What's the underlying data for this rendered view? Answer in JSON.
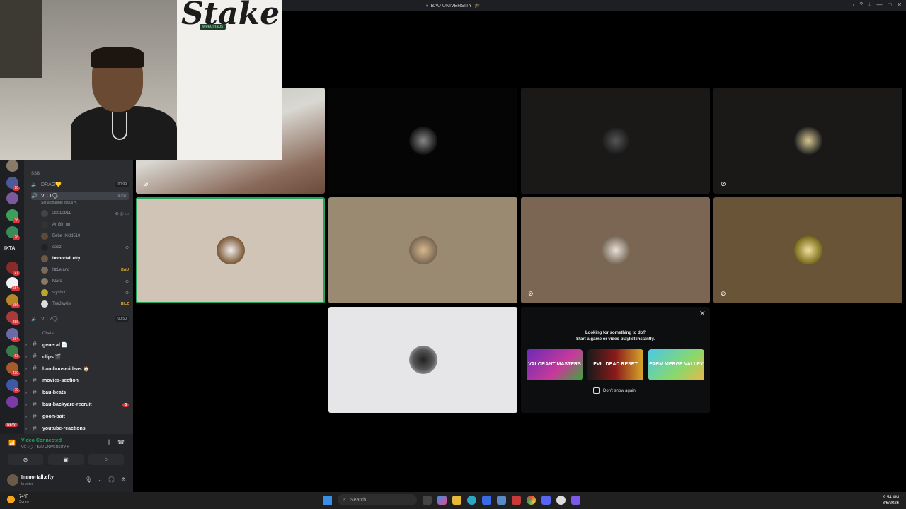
{
  "window": {
    "title": "BAU UNIVERSITY",
    "title_emoji": "🎓"
  },
  "webcam": {
    "logo_text": "Stake",
    "sponsor_text": "weedmaps"
  },
  "servers": {
    "badges": [
      "90",
      "36",
      "26",
      "27",
      "584",
      "156",
      "286",
      "164",
      "63",
      "430",
      "79"
    ],
    "text_server": "IXTA",
    "new_label": "NEW"
  },
  "channels": {
    "category_voice": "SSB",
    "voice_channels": [
      {
        "name": "DRAG💛",
        "limit": "00 99"
      },
      {
        "name": "VC 1🗣",
        "limit": "9 / 57"
      },
      {
        "name": "VC 2🗣",
        "limit": "00 50"
      }
    ],
    "status_hint": "Set a channel status ✎",
    "members": [
      {
        "name": "20010911",
        "tag": ""
      },
      {
        "name": "Am3ln nu",
        "tag": ""
      },
      {
        "name": "Bebe_Kidd510",
        "tag": ""
      },
      {
        "name": "ceez",
        "tag": ""
      },
      {
        "name": "Immortall.efty",
        "tag": ""
      },
      {
        "name": "ItzLeland",
        "tag": "BAU"
      },
      {
        "name": "Marc",
        "tag": ""
      },
      {
        "name": "siyshot1",
        "tag": ""
      },
      {
        "name": "TeeJay6ix",
        "tag": "BILZ"
      }
    ],
    "category_text": "Chats",
    "text_channels": [
      {
        "name": "general 📄",
        "badge": ""
      },
      {
        "name": "clips 🎬",
        "badge": ""
      },
      {
        "name": "bau-house-ideas 🏠",
        "badge": ""
      },
      {
        "name": "movies-section",
        "badge": ""
      },
      {
        "name": "bau-beats",
        "badge": ""
      },
      {
        "name": "bau-backyard-recruit",
        "badge": "3"
      },
      {
        "name": "goon-bait",
        "badge": ""
      },
      {
        "name": "youtube-reactions",
        "badge": ""
      }
    ]
  },
  "voice_status": {
    "connected": "Video Connected",
    "location": "VC 1🗣 / BAU UNIVERSITY🎓"
  },
  "user": {
    "name": "Immortall.efty",
    "status": "In voice"
  },
  "activity": {
    "line1": "Looking for something to do?",
    "line2": "Start a game or video playlist instantly.",
    "cards": [
      "VALORANT MASTERS",
      "EVIL DEAD RESET",
      "FARM MERGE VALLEY"
    ],
    "dont_show": "Don't show again"
  },
  "taskbar": {
    "temp": "74°F",
    "condition": "Sunny",
    "search": "Search",
    "time": "9:54 AM",
    "date": "8/6/2026"
  },
  "colors": {
    "accent_green": "#23a55a",
    "badge_red": "#da373c",
    "sidebar": "#2b2d31",
    "server_rail": "#1e1f22"
  }
}
